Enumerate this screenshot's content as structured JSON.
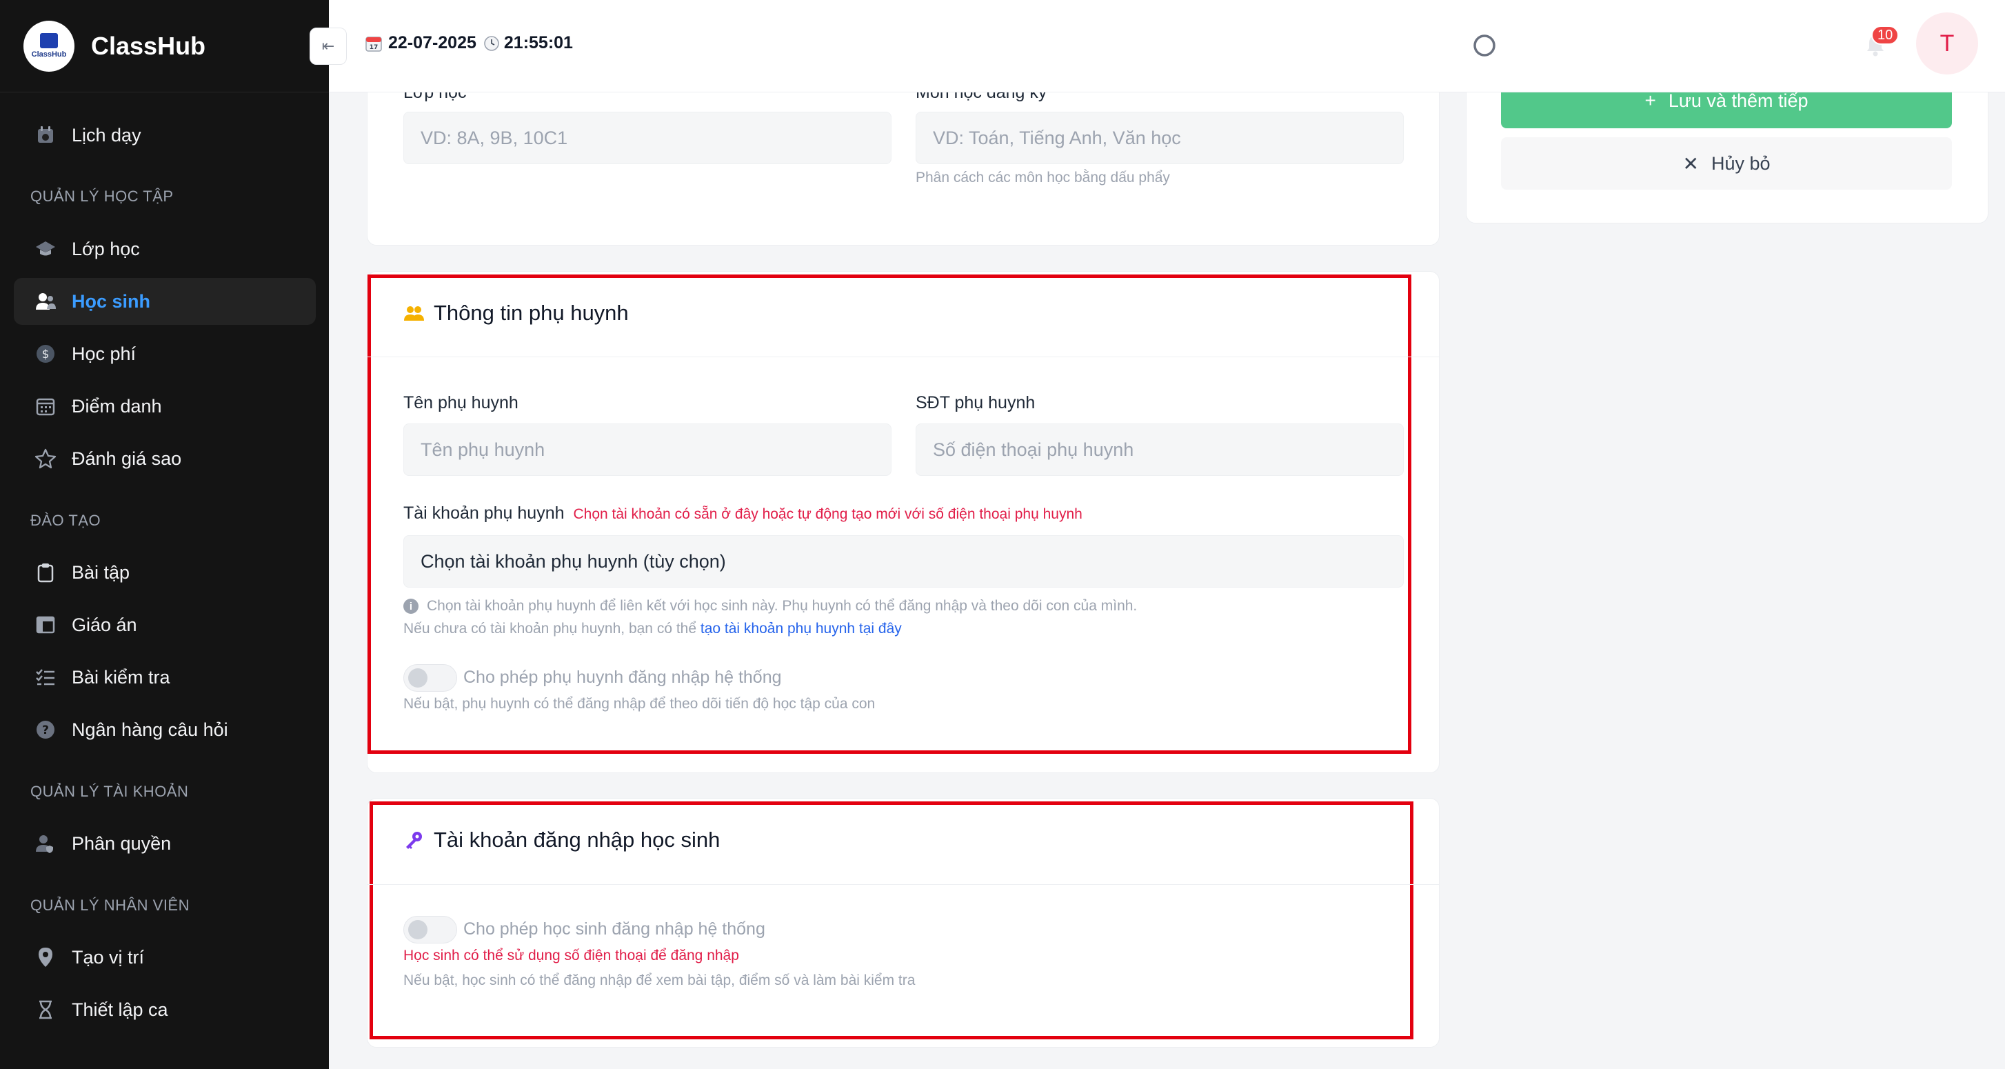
{
  "app": {
    "name": "ClassHub",
    "logo_text": "ClassHub"
  },
  "header": {
    "date": "22-07-2025",
    "time": "21:55:01",
    "notification_count": "10",
    "avatar_initial": "T"
  },
  "sidebar": {
    "top_item": "Lịch dạy",
    "sections": {
      "hoc_tap": "QUẢN LÝ HỌC TẬP",
      "dao_tao": "ĐÀO TẠO",
      "tai_khoan": "QUẢN LÝ TÀI KHOẢN",
      "nhan_vien": "QUẢN LÝ NHÂN VIÊN"
    },
    "items": {
      "lop_hoc": "Lớp học",
      "hoc_sinh": "Học sinh",
      "hoc_phi": "Học phí",
      "diem_danh": "Điểm danh",
      "danh_gia_sao": "Đánh giá sao",
      "bai_tap": "Bài tập",
      "giao_an": "Giáo án",
      "bai_kiem_tra": "Bài kiểm tra",
      "ngan_hang": "Ngân hàng câu hỏi",
      "phan_quyen": "Phân quyền",
      "tao_vi_tri": "Tạo vị trí",
      "thiet_lap_ca": "Thiết lập ca"
    },
    "active_item": "Học sinh"
  },
  "class_card": {
    "class_label": "Lớp học",
    "class_placeholder": "VD: 8A, 9B, 10C1",
    "subject_label": "Môn học đăng ký",
    "subject_placeholder": "VD: Toán, Tiếng Anh, Văn học",
    "subject_hint": "Phân cách các môn học bằng dấu phẩy"
  },
  "parent_card": {
    "title": "Thông tin phụ huynh",
    "name_label": "Tên phụ huynh",
    "name_placeholder": "Tên phụ huynh",
    "phone_label": "SĐT phụ huynh",
    "phone_placeholder": "Số điện thoại phụ huynh",
    "account_label": "Tài khoản phụ huynh",
    "account_note": "Chọn tài khoản có sẵn ở đây hoặc tự động tạo mới với số điện thoại phụ huynh",
    "account_select": "Chọn tài khoản phụ huynh (tùy chọn)",
    "info_line1": "Chọn tài khoản phụ huynh để liên kết với học sinh này. Phụ huynh có thể đăng nhập và theo dõi con của mình.",
    "info_line2_prefix": "Nếu chưa có tài khoản phụ huynh, bạn có thể",
    "info_line2_link": "tạo tài khoản phụ huynh tại đây",
    "toggle_label": "Cho phép phụ huynh đăng nhập hệ thống",
    "toggle_on": false,
    "toggle_hint": "Nếu bật, phụ huynh có thể đăng nhập để theo dõi tiến độ học tập của con"
  },
  "student_login_card": {
    "title": "Tài khoản đăng nhập học sinh",
    "toggle_label": "Cho phép học sinh đăng nhập hệ thống",
    "toggle_on": false,
    "red_hint": "Học sinh có thể sử dụng số điện thoại để đăng nhập",
    "toggle_hint": "Nếu bật, học sinh có thể đăng nhập để xem bài tập, điểm số và làm bài kiểm tra"
  },
  "actions": {
    "save_continue": "Lưu và thêm tiếp",
    "cancel": "Hủy bỏ"
  },
  "colors": {
    "sidebar_bg": "#141414",
    "active_text": "#3b9cff",
    "save_button": "#52c88a",
    "highlight_border": "#e3000f",
    "note_red": "#e11d48",
    "link_blue": "#2563eb"
  }
}
